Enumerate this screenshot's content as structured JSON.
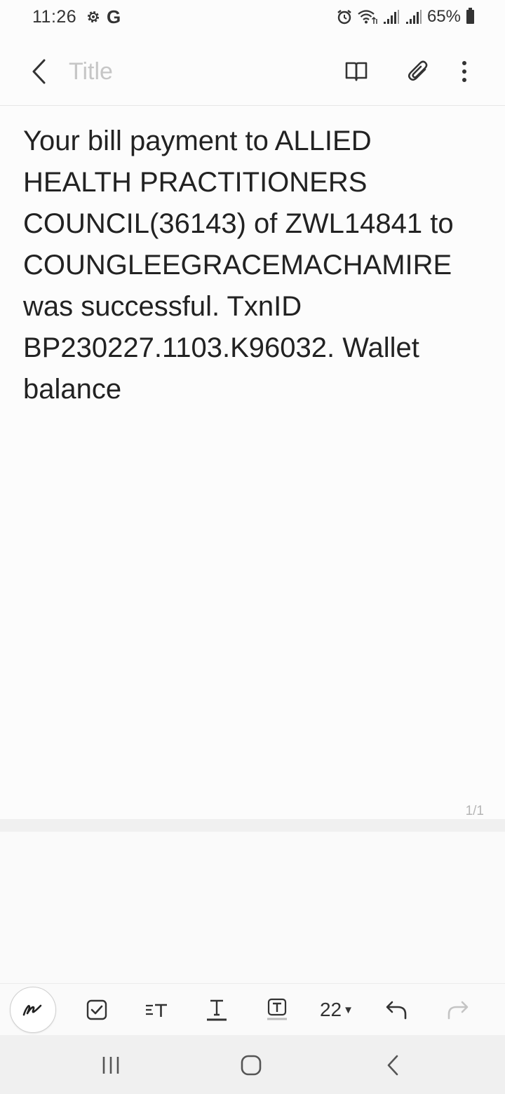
{
  "status_bar": {
    "time": "11:26",
    "battery_percent": "65%",
    "icons": [
      "settings-icon",
      "google-icon",
      "alarm-icon",
      "wifi-icon",
      "signal-icon",
      "signal-icon",
      "battery-icon"
    ],
    "google_letter": "G"
  },
  "title_bar": {
    "title_placeholder": "Title",
    "title_value": "",
    "icons": [
      "back-icon",
      "reading-mode-icon",
      "attach-icon",
      "more-icon"
    ]
  },
  "note": {
    "body": "Your bill payment to ALLIED HEALTH PRACTITIONERS COUNCIL(36143) of ZWL14841 to COUNGLEEGRACEMACHAMIRE was successful. TxnID BP230227.1103.K96032. Wallet balance",
    "page_indicator": "1/1"
  },
  "toolbar": {
    "font_size": "22",
    "tools": [
      "pen-icon",
      "checkbox-icon",
      "paragraph-style-icon",
      "text-style-icon",
      "text-background-icon",
      "font-size-dropdown",
      "undo-icon",
      "redo-icon"
    ]
  },
  "nav_bar": {
    "buttons": [
      "recent-apps-icon",
      "home-icon",
      "back-icon"
    ]
  },
  "colors": {
    "background": "#fcfcfc",
    "text": "#222222",
    "placeholder": "#c6c6c6",
    "nav_bar": "#f0f0f0"
  }
}
